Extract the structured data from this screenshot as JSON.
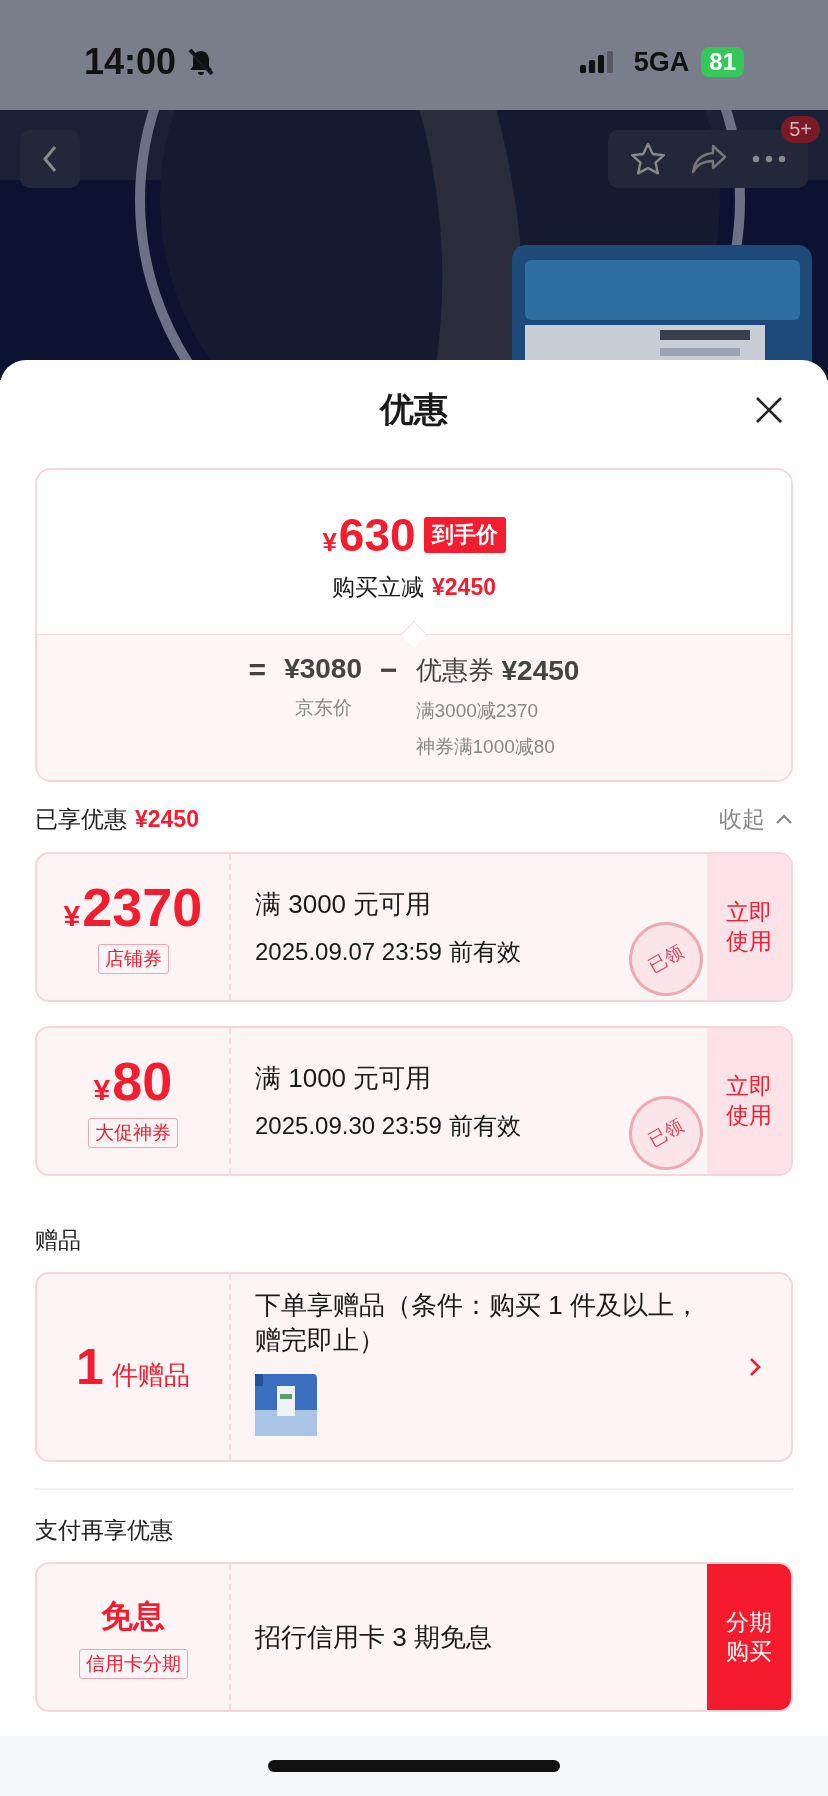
{
  "status_bar": {
    "time": "14:00",
    "network": "5GA",
    "battery": "81"
  },
  "nav": {
    "badge": "5+"
  },
  "sheet": {
    "title": "优惠"
  },
  "price_card": {
    "currency": "¥",
    "final_price": "630",
    "final_label": "到手价",
    "discount_label": "购买立减",
    "discount_amount": "¥2450",
    "equals": "=",
    "list_price": "¥3080",
    "list_price_label": "京东价",
    "minus": "−",
    "coupon_label": "优惠券",
    "coupon_total": "¥2450",
    "coupon_details": [
      "满3000减2370",
      "神券满1000减80"
    ]
  },
  "enjoyed": {
    "label": "已享优惠",
    "amount": "¥2450",
    "toggle": "收起",
    "expanded": true
  },
  "coupons": [
    {
      "currency": "¥",
      "amount": "2370",
      "tag": "店铺券",
      "condition": "满 3000 元可用",
      "validity": "2025.09.07 23:59 前有效",
      "action": "立即使用",
      "stamp": "已领"
    },
    {
      "currency": "¥",
      "amount": "80",
      "tag": "大促神券",
      "condition": "满 1000 元可用",
      "validity": "2025.09.30 23:59 前有效",
      "action": "立即使用",
      "stamp": "已领"
    }
  ],
  "gifts": {
    "title": "赠品",
    "count": "1",
    "count_label": "件赠品",
    "description": "下单享赠品（条件：购买 1 件及以上，赠完即止）"
  },
  "payment": {
    "title": "支付再享优惠",
    "offers": [
      {
        "title": "免息",
        "tag": "信用卡分期",
        "description": "招行信用卡 3 期免息",
        "action": "分期购买"
      }
    ]
  }
}
